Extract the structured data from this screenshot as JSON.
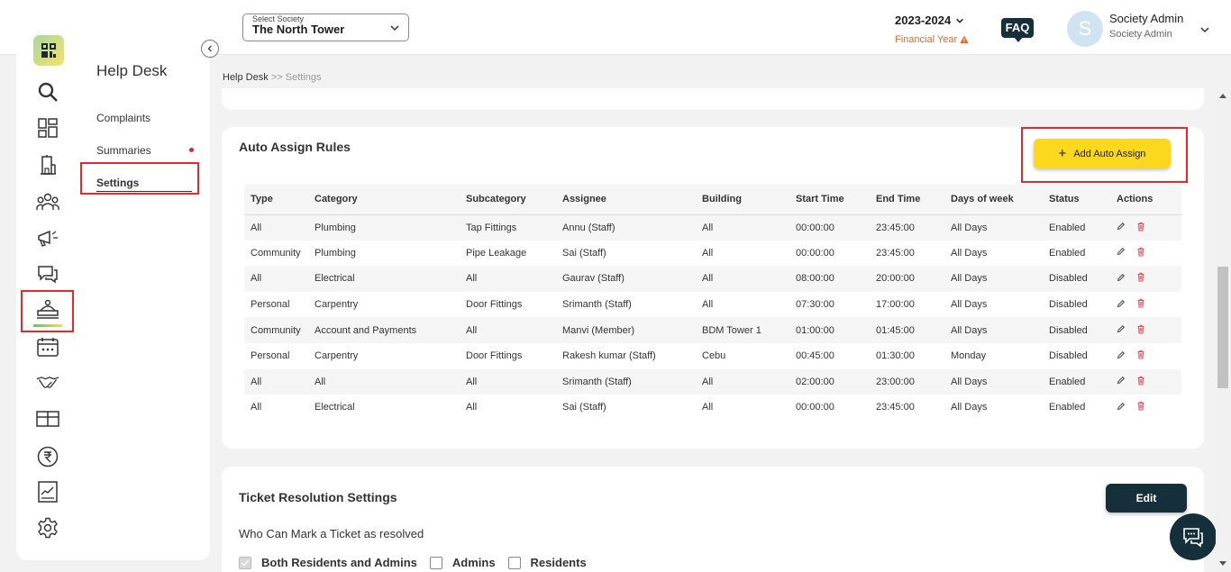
{
  "header": {
    "society_label": "Select Society",
    "society_value": "The North Tower",
    "financial_year": "2023-2024",
    "financial_year_label": "Financial Year",
    "faq_label": "FAQ",
    "avatar_letter": "S",
    "user_name": "Society Admin",
    "user_role": "Society Admin"
  },
  "sidebar": {
    "title": "Help Desk",
    "items": [
      {
        "label": "Complaints"
      },
      {
        "label": "Summaries"
      },
      {
        "label": "Settings"
      }
    ],
    "rail_icons": [
      "search-icon",
      "dashboard-icon",
      "building-icon",
      "community-icon",
      "announcement-icon",
      "chat-icon",
      "helpdesk-icon",
      "calendar-icon",
      "handshake-icon",
      "amenities-icon",
      "rupee-icon",
      "reports-icon",
      "settings-icon"
    ]
  },
  "breadcrumb": {
    "root": "Help Desk",
    "sep": ">>",
    "current": "Settings"
  },
  "auto_assign": {
    "title": "Auto Assign Rules",
    "add_button": "Add Auto Assign",
    "columns": [
      "Type",
      "Category",
      "Subcategory",
      "Assignee",
      "Building",
      "Start Time",
      "End Time",
      "Days of week",
      "Status",
      "Actions"
    ],
    "rows": [
      [
        "All",
        "Plumbing",
        "Tap Fittings",
        "Annu (Staff)",
        "All",
        "00:00:00",
        "23:45:00",
        "All Days",
        "Enabled"
      ],
      [
        "Community",
        "Plumbing",
        "Pipe Leakage",
        "Sai (Staff)",
        "All",
        "00:00:00",
        "23:45:00",
        "All Days",
        "Enabled"
      ],
      [
        "All",
        "Electrical",
        "All",
        "Gaurav (Staff)",
        "All",
        "08:00:00",
        "20:00:00",
        "All Days",
        "Disabled"
      ],
      [
        "Personal",
        "Carpentry",
        "Door Fittings",
        "Srimanth (Staff)",
        "All",
        "07:30:00",
        "17:00:00",
        "All Days",
        "Disabled"
      ],
      [
        "Community",
        "Account and Payments",
        "All",
        "Manvi (Member)",
        "BDM Tower 1",
        "01:00:00",
        "01:45:00",
        "All Days",
        "Disabled"
      ],
      [
        "Personal",
        "Carpentry",
        "Door Fittings",
        "Rakesh kumar (Staff)",
        "Cebu",
        "00:45:00",
        "01:30:00",
        "Monday",
        "Disabled"
      ],
      [
        "All",
        "All",
        "All",
        "Srimanth (Staff)",
        "All",
        "02:00:00",
        "23:00:00",
        "All Days",
        "Enabled"
      ],
      [
        "All",
        "Electrical",
        "All",
        "Sai (Staff)",
        "All",
        "00:00:00",
        "23:45:00",
        "All Days",
        "Enabled"
      ]
    ]
  },
  "resolution": {
    "title": "Ticket Resolution Settings",
    "edit_button": "Edit",
    "question": "Who Can Mark a Ticket as resolved",
    "options": [
      {
        "label": "Both Residents and Admins",
        "checked": true
      },
      {
        "label": "Admins",
        "checked": false
      },
      {
        "label": "Residents",
        "checked": false
      }
    ]
  },
  "colors": {
    "accent_yellow": "#fbd81e",
    "dark_teal": "#15303a",
    "highlight_red": "#e22a2a",
    "warning_orange": "#e0662a"
  }
}
